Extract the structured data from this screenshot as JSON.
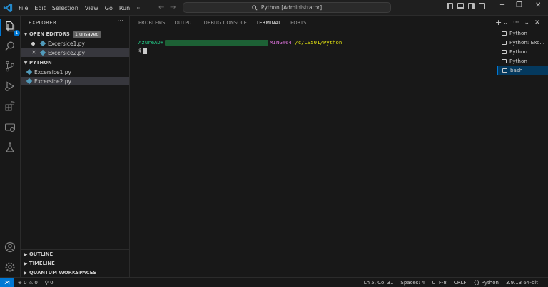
{
  "titlebar": {
    "menu": [
      "File",
      "Edit",
      "Selection",
      "View",
      "Go",
      "Run",
      "···"
    ],
    "search_text": "Python [Administrator]"
  },
  "activitybar": {
    "explorer_badge": "1",
    "icons": [
      "files-icon",
      "search-icon",
      "source-control-icon",
      "run-debug-icon",
      "extensions-icon",
      "remote-explorer-icon",
      "testing-icon",
      "account-icon",
      "settings-gear-icon"
    ]
  },
  "sidebar": {
    "title": "EXPLORER",
    "more": "···",
    "open_editors": {
      "label": "OPEN EDITORS",
      "badge": "1 unsaved",
      "files": [
        "Excersice1.py",
        "Excersice2.py"
      ]
    },
    "folder": {
      "label": "PYTHON",
      "files": [
        "Excersice1.py",
        "Excersice2.py"
      ]
    },
    "bottom_sections": [
      "OUTLINE",
      "TIMELINE",
      "QUANTUM WORKSPACES"
    ]
  },
  "panel": {
    "tabs": [
      "PROBLEMS",
      "OUTPUT",
      "DEBUG CONSOLE",
      "TERMINAL",
      "PORTS"
    ],
    "active_tab": "TERMINAL",
    "actions": {
      "add": "+",
      "dropdown": "⌄",
      "more": "···",
      "chevron": "⌄",
      "close": "✕"
    },
    "terminal": {
      "user_prefix": "AzureAD+",
      "host": "MINGW64",
      "path": "/c/CS501/Python",
      "prompt": "$"
    },
    "terminal_list": [
      "Python",
      "Python: Exc...",
      "Python",
      "Python",
      "bash"
    ]
  },
  "statusbar": {
    "remote": "⋊",
    "errors": "0",
    "warnings": "0",
    "ports": "0",
    "position": "Ln 5, Col 31",
    "spaces": "Spaces: 4",
    "encoding": "UTF-8",
    "eol": "CRLF",
    "language": "Python",
    "interpreter": "3.9.13 64-bit"
  },
  "colors": {
    "accent": "#0078d4",
    "terminal_user": "#23d18b",
    "terminal_host": "#d670d6",
    "terminal_path": "#e5e510",
    "python_icon": "#519aba"
  }
}
